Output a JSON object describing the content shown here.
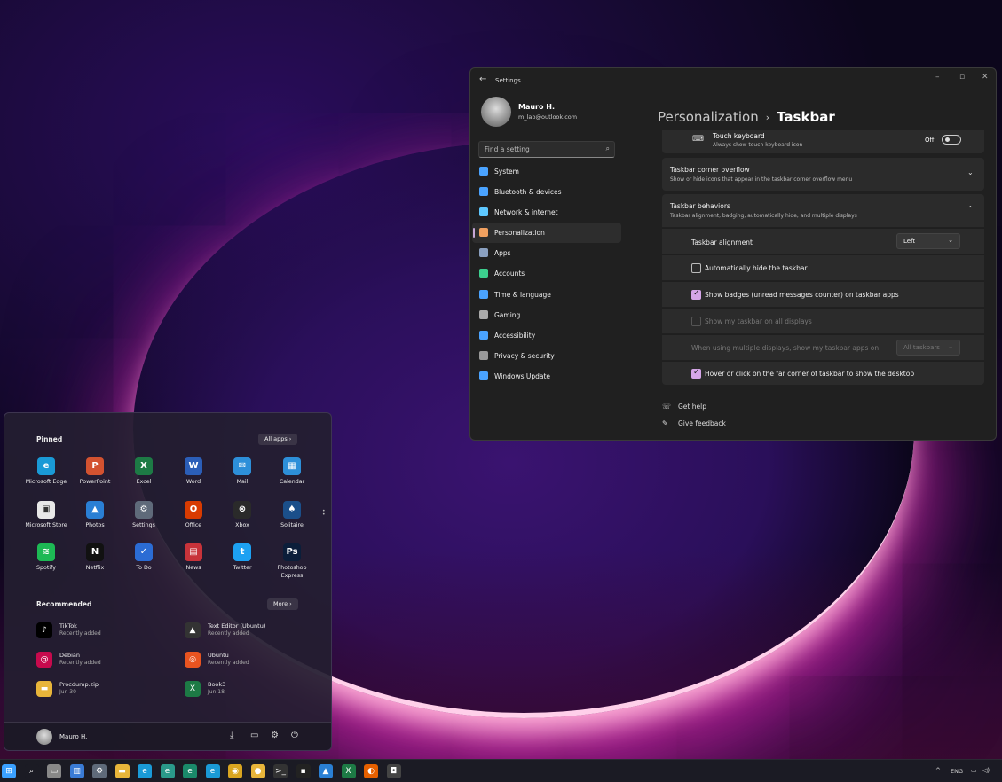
{
  "settings": {
    "title": "Settings",
    "profile": {
      "name": "Mauro H.",
      "email": "m_lab@outlook.com"
    },
    "search_placeholder": "Find a setting",
    "nav": [
      {
        "label": "System",
        "icon": "monitor-icon",
        "color": "#4aa3ff"
      },
      {
        "label": "Bluetooth & devices",
        "icon": "bluetooth-icon",
        "color": "#4aa3ff"
      },
      {
        "label": "Network & internet",
        "icon": "wifi-icon",
        "color": "#5ec8ff"
      },
      {
        "label": "Personalization",
        "icon": "brush-icon",
        "color": "#f0a060",
        "active": true
      },
      {
        "label": "Apps",
        "icon": "apps-icon",
        "color": "#8aa0c0"
      },
      {
        "label": "Accounts",
        "icon": "person-icon",
        "color": "#3ccf8e"
      },
      {
        "label": "Time & language",
        "icon": "globe-icon",
        "color": "#4aa3ff"
      },
      {
        "label": "Gaming",
        "icon": "controller-icon",
        "color": "#aaaaaa"
      },
      {
        "label": "Accessibility",
        "icon": "accessibility-icon",
        "color": "#4aa3ff"
      },
      {
        "label": "Privacy & security",
        "icon": "shield-icon",
        "color": "#999999"
      },
      {
        "label": "Windows Update",
        "icon": "update-icon",
        "color": "#4aa3ff"
      }
    ],
    "breadcrumb": {
      "parent": "Personalization",
      "separator": "›",
      "current": "Taskbar"
    },
    "touch_keyboard": {
      "title": "Touch keyboard",
      "subtitle": "Always show touch keyboard icon",
      "state": "Off"
    },
    "corner_overflow": {
      "title": "Taskbar corner overflow",
      "subtitle": "Show or hide icons that appear in the taskbar corner overflow menu"
    },
    "behaviors": {
      "title": "Taskbar behaviors",
      "subtitle": "Taskbar alignment, badging, automatically hide, and multiple displays",
      "alignment_label": "Taskbar alignment",
      "alignment_value": "Left",
      "auto_hide": "Automatically hide the taskbar",
      "badges": "Show badges (unread messages counter) on taskbar apps",
      "all_displays": "Show my taskbar on all displays",
      "multi_label": "When using multiple displays, show my taskbar apps on",
      "multi_value": "All taskbars",
      "far_corner": "Hover or click on the far corner of taskbar to show the desktop"
    },
    "help": {
      "get_help": "Get help",
      "feedback": "Give feedback"
    }
  },
  "start": {
    "pinned_title": "Pinned",
    "all_apps": "All apps  ›",
    "pinned": [
      {
        "label": "Microsoft Edge",
        "icon": "edge-icon",
        "color": "#1a9ad6",
        "glyph": "e"
      },
      {
        "label": "PowerPoint",
        "icon": "powerpoint-icon",
        "color": "#d35230",
        "glyph": "P"
      },
      {
        "label": "Excel",
        "icon": "excel-icon",
        "color": "#1d7a45",
        "glyph": "X"
      },
      {
        "label": "Word",
        "icon": "word-icon",
        "color": "#2b5eb8",
        "glyph": "W"
      },
      {
        "label": "Mail",
        "icon": "mail-icon",
        "color": "#2d8fd9",
        "glyph": "✉"
      },
      {
        "label": "Calendar",
        "icon": "calendar-icon",
        "color": "#2d8fd9",
        "glyph": "▦"
      },
      {
        "label": "Microsoft Store",
        "icon": "store-icon",
        "color": "#e8e8e8",
        "glyph": "▣"
      },
      {
        "label": "Photos",
        "icon": "photos-icon",
        "color": "#2a7fd4",
        "glyph": "▲"
      },
      {
        "label": "Settings",
        "icon": "gear-icon",
        "color": "#5f6a7a",
        "glyph": "⚙"
      },
      {
        "label": "Office",
        "icon": "office-icon",
        "color": "#d83b01",
        "glyph": "O"
      },
      {
        "label": "Xbox",
        "icon": "xbox-icon",
        "color": "#2a2a2a",
        "glyph": "⊗"
      },
      {
        "label": "Solitaire",
        "icon": "solitaire-icon",
        "color": "#1b4f8a",
        "glyph": "♠"
      },
      {
        "label": "Spotify",
        "icon": "spotify-icon",
        "color": "#1db954",
        "glyph": "≋"
      },
      {
        "label": "Netflix",
        "icon": "netflix-icon",
        "color": "#111111",
        "glyph": "N"
      },
      {
        "label": "To Do",
        "icon": "todo-icon",
        "color": "#2b6cd4",
        "glyph": "✓"
      },
      {
        "label": "News",
        "icon": "news-icon",
        "color": "#c8333a",
        "glyph": "▤"
      },
      {
        "label": "Twitter",
        "icon": "twitter-icon",
        "color": "#1da1f2",
        "glyph": "t"
      },
      {
        "label": "Photoshop Express",
        "icon": "photoshop-icon",
        "color": "#0b1e3a",
        "glyph": "Ps"
      }
    ],
    "recommended_title": "Recommended",
    "more": "More  ›",
    "recommended": [
      {
        "name": "TikTok",
        "sub": "Recently added",
        "icon": "tiktok-icon",
        "color": "#000000",
        "glyph": "♪"
      },
      {
        "name": "Text Editor (Ubuntu)",
        "sub": "Recently added",
        "icon": "penguin-icon",
        "color": "#333333",
        "glyph": "▲"
      },
      {
        "name": "Debian",
        "sub": "Recently added",
        "icon": "debian-icon",
        "color": "#c70a4d",
        "glyph": "@"
      },
      {
        "name": "Ubuntu",
        "sub": "Recently added",
        "icon": "ubuntu-icon",
        "color": "#e95420",
        "glyph": "◎"
      },
      {
        "name": "Procdump.zip",
        "sub": "Jun 30",
        "icon": "folder-icon",
        "color": "#e8b53a",
        "glyph": "▬"
      },
      {
        "name": "Book3",
        "sub": "Jun 18",
        "icon": "excel-file-icon",
        "color": "#1d7a45",
        "glyph": "X"
      }
    ],
    "user": "Mauro H."
  },
  "taskbar": {
    "icons": [
      {
        "icon": "windows-icon",
        "color": "#3aa0ff",
        "glyph": "⊞"
      },
      {
        "icon": "search-icon",
        "color": "#1b1b24",
        "glyph": "⌕"
      },
      {
        "icon": "task-view-icon",
        "color": "#888888",
        "glyph": "▭"
      },
      {
        "icon": "widgets-icon",
        "color": "#3a7bd5",
        "glyph": "▥"
      },
      {
        "icon": "settings-icon",
        "color": "#5f6a7a",
        "glyph": "⚙"
      },
      {
        "icon": "file-explorer-icon",
        "color": "#e8b53a",
        "glyph": "▬"
      },
      {
        "icon": "edge-icon",
        "color": "#1a9ad6",
        "glyph": "e"
      },
      {
        "icon": "edge-beta-icon",
        "color": "#2a9a8a",
        "glyph": "e"
      },
      {
        "icon": "edge-dev-icon",
        "color": "#1a8a6a",
        "glyph": "e"
      },
      {
        "icon": "edge-canary-icon",
        "color": "#1a9ad6",
        "glyph": "e"
      },
      {
        "icon": "chrome-icon",
        "color": "#d9a520",
        "glyph": "◉"
      },
      {
        "icon": "chrome-canary-icon",
        "color": "#e8b53a",
        "glyph": "●"
      },
      {
        "icon": "terminal-icon",
        "color": "#333333",
        "glyph": ">_"
      },
      {
        "icon": "command-prompt-icon",
        "color": "#222222",
        "glyph": "▪"
      },
      {
        "icon": "photos-icon",
        "color": "#2a7fd4",
        "glyph": "▲"
      },
      {
        "icon": "excel-icon",
        "color": "#1d7a45",
        "glyph": "X"
      },
      {
        "icon": "firefox-icon",
        "color": "#e66000",
        "glyph": "◐"
      },
      {
        "icon": "camera-icon",
        "color": "#444444",
        "glyph": "◘"
      }
    ],
    "tray_chevron": "^",
    "lang": "ENG"
  }
}
